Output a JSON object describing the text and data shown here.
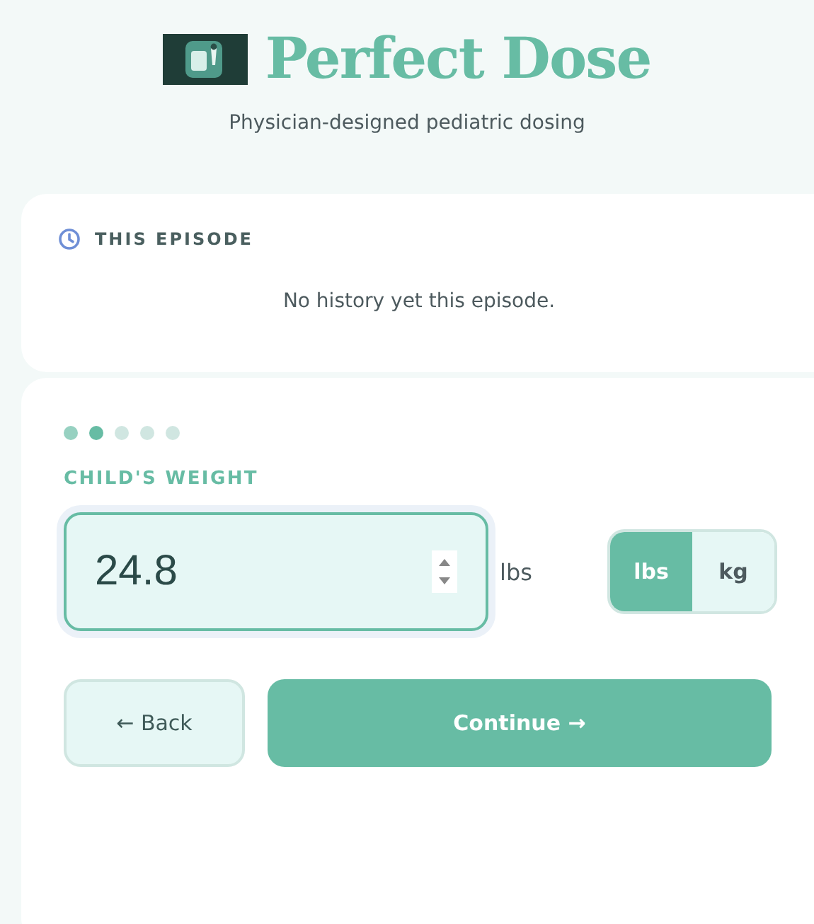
{
  "header": {
    "title": "Perfect Dose",
    "subtitle": "Physician-designed pediatric dosing"
  },
  "history": {
    "title": "THIS EPISODE",
    "empty_text": "No history yet this episode."
  },
  "steps": [
    {
      "done": true,
      "selected": false
    },
    {
      "done": true,
      "selected": true
    },
    {
      "done": false,
      "selected": false
    },
    {
      "done": false,
      "selected": false
    },
    {
      "done": false,
      "selected": false
    }
  ],
  "weight": {
    "label": "CHILD'S WEIGHT",
    "value": "24.8",
    "unit_label": "lbs",
    "units": [
      {
        "label": "lbs",
        "selected": true
      },
      {
        "label": "kg",
        "selected": false
      }
    ]
  },
  "buttons": {
    "back": "← Back",
    "continue": "Continue →"
  }
}
